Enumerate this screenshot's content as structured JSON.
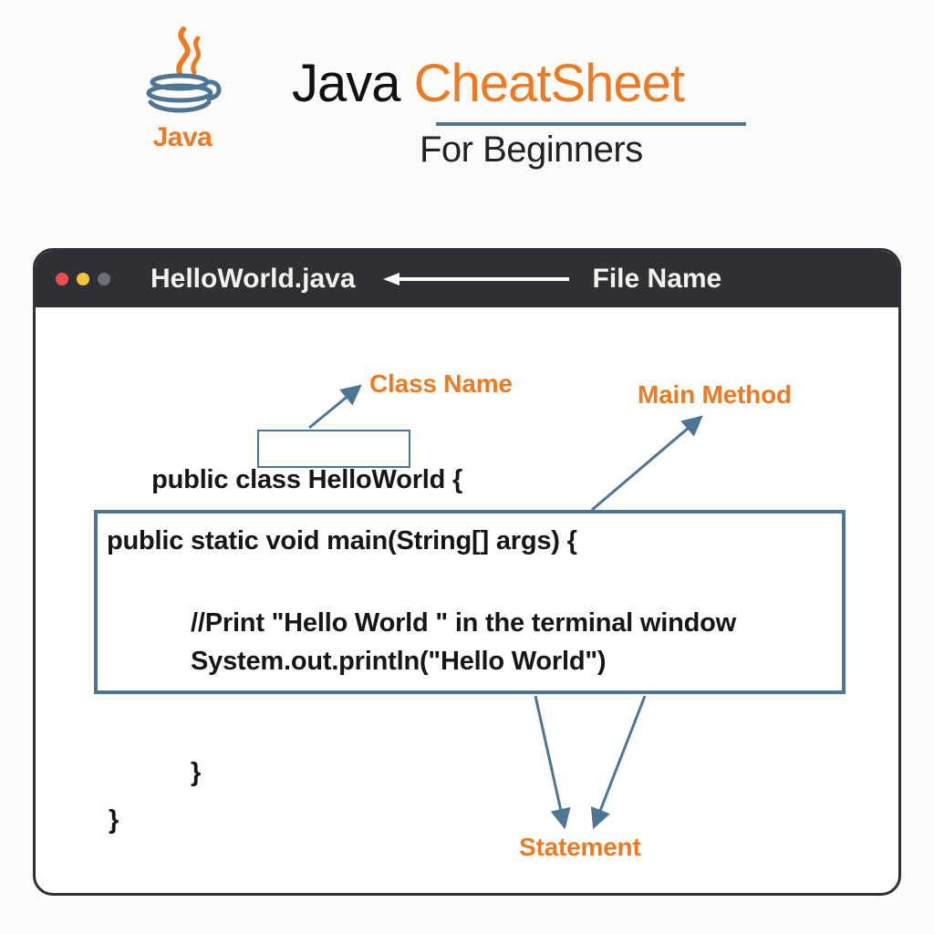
{
  "colors": {
    "accent_orange": "#ea7a24",
    "accent_blue": "#4e7594",
    "window_chrome": "#2e3033"
  },
  "header": {
    "logo_text": "Java",
    "title_part1": "Java ",
    "title_part2": "CheatSheet",
    "subtitle": "For Beginners"
  },
  "window": {
    "file_name": "HelloWorld.java",
    "file_name_label": "File Name"
  },
  "labels": {
    "class_name": "Class Name",
    "main_method": "Main Method",
    "statement": "Statement"
  },
  "code": {
    "line1_pre": "public class ",
    "line1_name": "HelloWorld",
    "line1_post": " {",
    "line2": "public static void main(String[] args) {",
    "line3": "//Print \"Hello World \" in the terminal window",
    "line4": "System.out.println(\"Hello World\")",
    "line5": "}",
    "line6": "}"
  }
}
